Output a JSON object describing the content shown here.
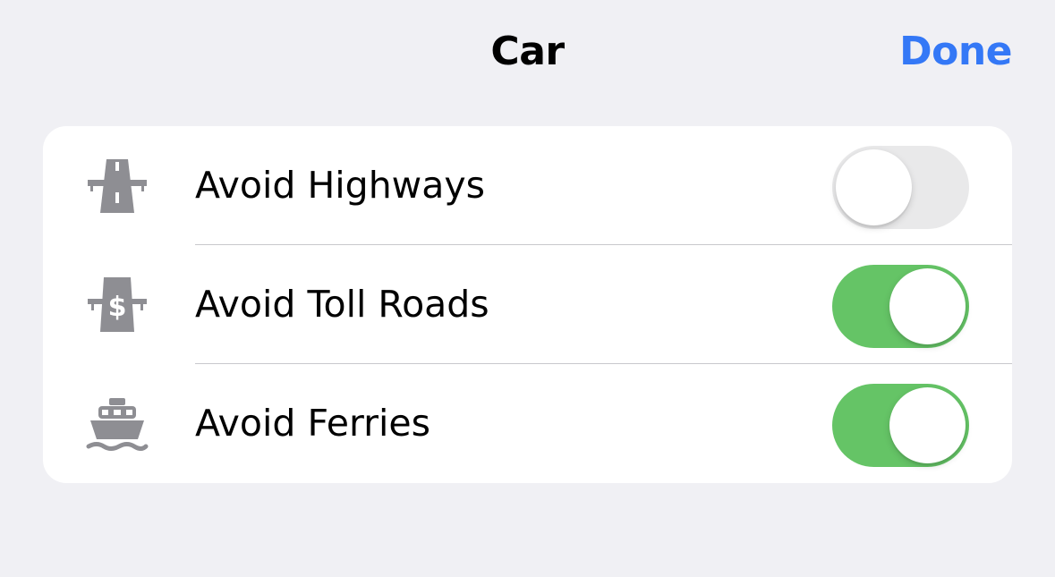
{
  "header": {
    "title": "Car",
    "done_label": "Done"
  },
  "colors": {
    "accent": "#3478f6",
    "toggle_on": "#65c466",
    "toggle_off": "#e9e9ea",
    "icon": "#8e8e93",
    "background": "#f0f0f4"
  },
  "options": [
    {
      "label": "Avoid Highways",
      "icon": "highway-icon",
      "enabled": false
    },
    {
      "label": "Avoid Toll Roads",
      "icon": "toll-road-icon",
      "enabled": true
    },
    {
      "label": "Avoid Ferries",
      "icon": "ferry-icon",
      "enabled": true
    }
  ]
}
